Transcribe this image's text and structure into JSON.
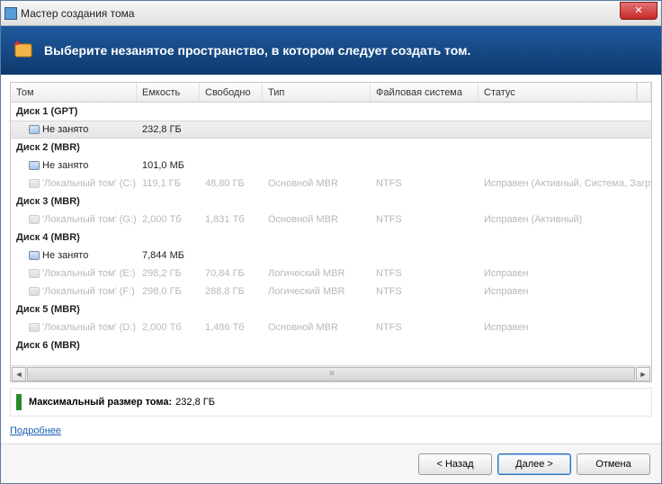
{
  "window": {
    "title": "Мастер создания тома"
  },
  "banner": {
    "text": "Выберите незанятое пространство, в котором следует создать том."
  },
  "columns": {
    "vol": "Том",
    "cap": "Емкость",
    "free": "Свободно",
    "type": "Тип",
    "fs": "Файловая система",
    "status": "Статус"
  },
  "disks": [
    {
      "label": "Диск 1 (GPT)",
      "rows": [
        {
          "vol": "Не занято",
          "cap": "232,8 ГБ",
          "free": "",
          "type": "",
          "fs": "",
          "status": "",
          "selected": true,
          "disabled": false
        }
      ]
    },
    {
      "label": "Диск 2 (MBR)",
      "rows": [
        {
          "vol": "Не занято",
          "cap": "101,0 МБ",
          "free": "",
          "type": "",
          "fs": "",
          "status": "",
          "selected": false,
          "disabled": false
        },
        {
          "vol": "'Локальный том' (C:)",
          "cap": "119,1 ГБ",
          "free": "48,80 ГБ",
          "type": "Основной MBR",
          "fs": "NTFS",
          "status": "Исправен (Активный, Система, Загрузка)",
          "selected": false,
          "disabled": true
        }
      ]
    },
    {
      "label": "Диск 3 (MBR)",
      "rows": [
        {
          "vol": "'Локальный том' (G:)",
          "cap": "2,000 Тб",
          "free": "1,831 Тб",
          "type": "Основной MBR",
          "fs": "NTFS",
          "status": "Исправен (Активный)",
          "selected": false,
          "disabled": true
        }
      ]
    },
    {
      "label": "Диск 4 (MBR)",
      "rows": [
        {
          "vol": "Не занято",
          "cap": "7,844 МБ",
          "free": "",
          "type": "",
          "fs": "",
          "status": "",
          "selected": false,
          "disabled": false
        },
        {
          "vol": "'Локальный том' (E:)",
          "cap": "298,2 ГБ",
          "free": "70,84 ГБ",
          "type": "Логический MBR",
          "fs": "NTFS",
          "status": "Исправен",
          "selected": false,
          "disabled": true
        },
        {
          "vol": "'Локальный том' (F:)",
          "cap": "298,0 ГБ",
          "free": "288,8 ГБ",
          "type": "Логический MBR",
          "fs": "NTFS",
          "status": "Исправен",
          "selected": false,
          "disabled": true
        }
      ]
    },
    {
      "label": "Диск 5 (MBR)",
      "rows": [
        {
          "vol": "'Локальный том' (D:)",
          "cap": "2,000 Тб",
          "free": "1,486 Тб",
          "type": "Основной MBR",
          "fs": "NTFS",
          "status": "Исправен",
          "selected": false,
          "disabled": true
        }
      ]
    },
    {
      "label": "Диск 6 (MBR)",
      "rows": []
    }
  ],
  "maxsize": {
    "label": "Максимальный размер тома:",
    "value": "232,8 ГБ"
  },
  "more_link": "Подробнее",
  "buttons": {
    "back": "< Назад",
    "next": "Далее >",
    "cancel": "Отмена"
  }
}
